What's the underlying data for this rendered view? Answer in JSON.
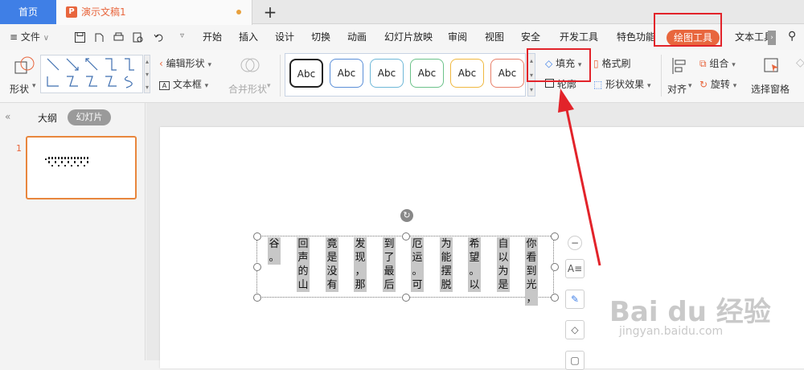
{
  "tabs": {
    "home": "首页",
    "document": "演示文稿1"
  },
  "menu": {
    "file": "文件",
    "items": [
      "开始",
      "插入",
      "设计",
      "切换",
      "动画",
      "幻灯片放映",
      "审阅",
      "视图",
      "安全",
      "开发工具",
      "特色功能"
    ],
    "drawing_tools": "绘图工具",
    "text_tools": "文本工具"
  },
  "ribbon": {
    "shape": "形状",
    "edit_shape": "编辑形状",
    "text_box": "文本框",
    "merge_shape": "合并形状",
    "styles": [
      "Abc",
      "Abc",
      "Abc",
      "Abc",
      "Abc",
      "Abc"
    ],
    "style_border_colors": [
      "#222222",
      "#5b8fd8",
      "#6fb8d8",
      "#6cc28a",
      "#f0b840",
      "#e8806a"
    ],
    "fill": "填充",
    "outline": "轮廓",
    "format_painter": "格式刷",
    "shape_effects": "形状效果",
    "align": "对齐",
    "group": "组合",
    "rotate": "旋转",
    "selection_pane": "选择窗格"
  },
  "leftpane": {
    "outline_tab": "大纲",
    "slides_tab": "幻灯片",
    "slide_number": "1"
  },
  "textbox": {
    "columns": [
      "你看到光，",
      "自以为是",
      "希望。以",
      "为能摆脱",
      "厄运。可",
      "到了最后",
      "发现，那",
      "竟是没有",
      "回声的山",
      "谷。"
    ]
  },
  "watermark": {
    "main": "Bai du 经验",
    "sub": "jingyan.baidu.com"
  },
  "colors": {
    "accent": "#e8663d",
    "highlight": "#e2232a",
    "blue_tab": "#3f7fe6"
  }
}
